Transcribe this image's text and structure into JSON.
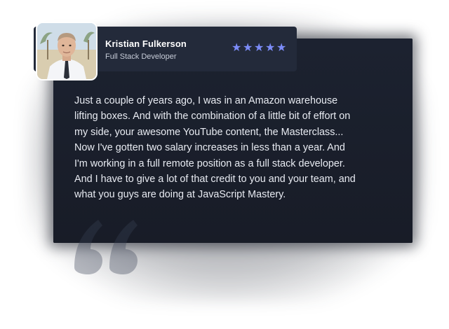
{
  "testimonial": {
    "name": "Kristian Fulkerson",
    "role": "Full Stack Developer",
    "rating": 5,
    "rating_max": 5,
    "star_glyph": "★",
    "star_color": "#7c8cf8",
    "text": "Just a couple of years ago, I was in an Amazon warehouse\nlifting boxes. And with the combination of a little bit of effort on\nmy side, your awesome YouTube content, the Masterclass...\nNow I've gotten two salary increases in less than a year. And\nI'm working in a full remote position as a full stack developer.\nAnd I have to give a lot of that credit to you and your team, and\nwhat you guys are doing at JavaScript Mastery."
  },
  "icons": {
    "quote": "quote-icon",
    "avatar": "person-photo"
  },
  "colors": {
    "card_bg": "#1a1f2b",
    "header_bg": "#232a3a",
    "text": "#e8ebf2",
    "subtext": "#c7ccd8"
  }
}
